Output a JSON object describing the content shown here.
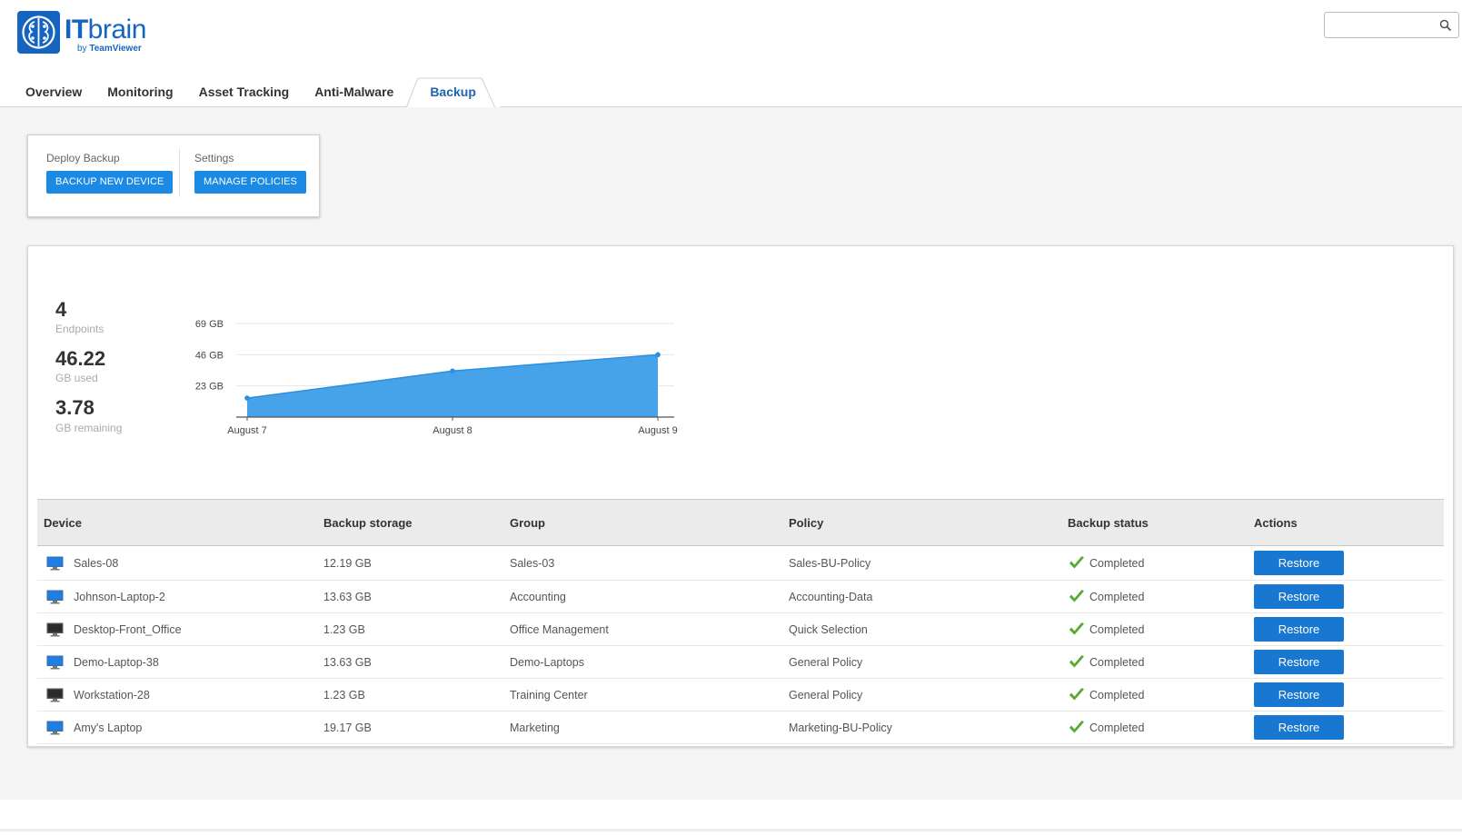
{
  "brand": {
    "name_bold": "IT",
    "name_rest": "brain",
    "sub_prefix": "by",
    "sub_name": "TeamViewer",
    "color": "#1565c0",
    "icon": "brain-logo-icon"
  },
  "search": {
    "placeholder": "",
    "value": "",
    "icon": "search-icon"
  },
  "tabs": [
    {
      "label": "Overview",
      "active": false
    },
    {
      "label": "Monitoring",
      "active": false
    },
    {
      "label": "Asset Tracking",
      "active": false
    },
    {
      "label": "Anti-Malware",
      "active": false
    },
    {
      "label": "Backup",
      "active": true
    }
  ],
  "actions": {
    "deploy_label": "Deploy Backup",
    "deploy_button": "BACKUP NEW DEVICE",
    "settings_label": "Settings",
    "settings_button": "MANAGE POLICIES",
    "button_color": "#1a8ae5"
  },
  "stats": [
    {
      "value": "4",
      "label": "Endpoints"
    },
    {
      "value": "46.22",
      "label": "GB used"
    },
    {
      "value": "3.78",
      "label": "GB remaining"
    }
  ],
  "chart_data": {
    "type": "area",
    "x": [
      "August 7",
      "August 8",
      "August 9"
    ],
    "series": [
      {
        "values": [
          14,
          34,
          46
        ]
      }
    ],
    "y_ticks": [
      "23 GB",
      "46 GB",
      "69 GB"
    ],
    "ylim": [
      0,
      69
    ],
    "grid": true,
    "color": "#46a3ea"
  },
  "table": {
    "columns": [
      "Device",
      "Backup storage",
      "Group",
      "Policy",
      "Backup status",
      "Actions"
    ],
    "rows": [
      {
        "device": "Sales-08",
        "device_icon": "monitor-blue-icon",
        "storage": "12.19 GB",
        "group": "Sales-03",
        "policy": "Sales-BU-Policy",
        "status": "Completed",
        "action": "Restore"
      },
      {
        "device": "Johnson-Laptop-2",
        "device_icon": "monitor-blue-icon",
        "storage": "13.63 GB",
        "group": "Accounting",
        "policy": "Accounting-Data",
        "status": "Completed",
        "action": "Restore"
      },
      {
        "device": "Desktop-Front_Office",
        "device_icon": "monitor-dark-icon",
        "storage": "1.23 GB",
        "group": "Office Management",
        "policy": "Quick Selection",
        "status": "Completed",
        "action": "Restore"
      },
      {
        "device": "Demo-Laptop-38",
        "device_icon": "monitor-blue-icon",
        "storage": "13.63 GB",
        "group": "Demo-Laptops",
        "policy": "General Policy",
        "status": "Completed",
        "action": "Restore"
      },
      {
        "device": "Workstation-28",
        "device_icon": "monitor-dark-icon",
        "storage": "1.23 GB",
        "group": "Training Center",
        "policy": "General Policy",
        "status": "Completed",
        "action": "Restore"
      },
      {
        "device": "Amy's Laptop",
        "device_icon": "monitor-blue-icon",
        "storage": "19.17 GB",
        "group": "Marketing",
        "policy": "Marketing-BU-Policy",
        "status": "Completed",
        "action": "Restore"
      }
    ],
    "status_color": "#5aa832",
    "restore_color": "#1877d1"
  }
}
